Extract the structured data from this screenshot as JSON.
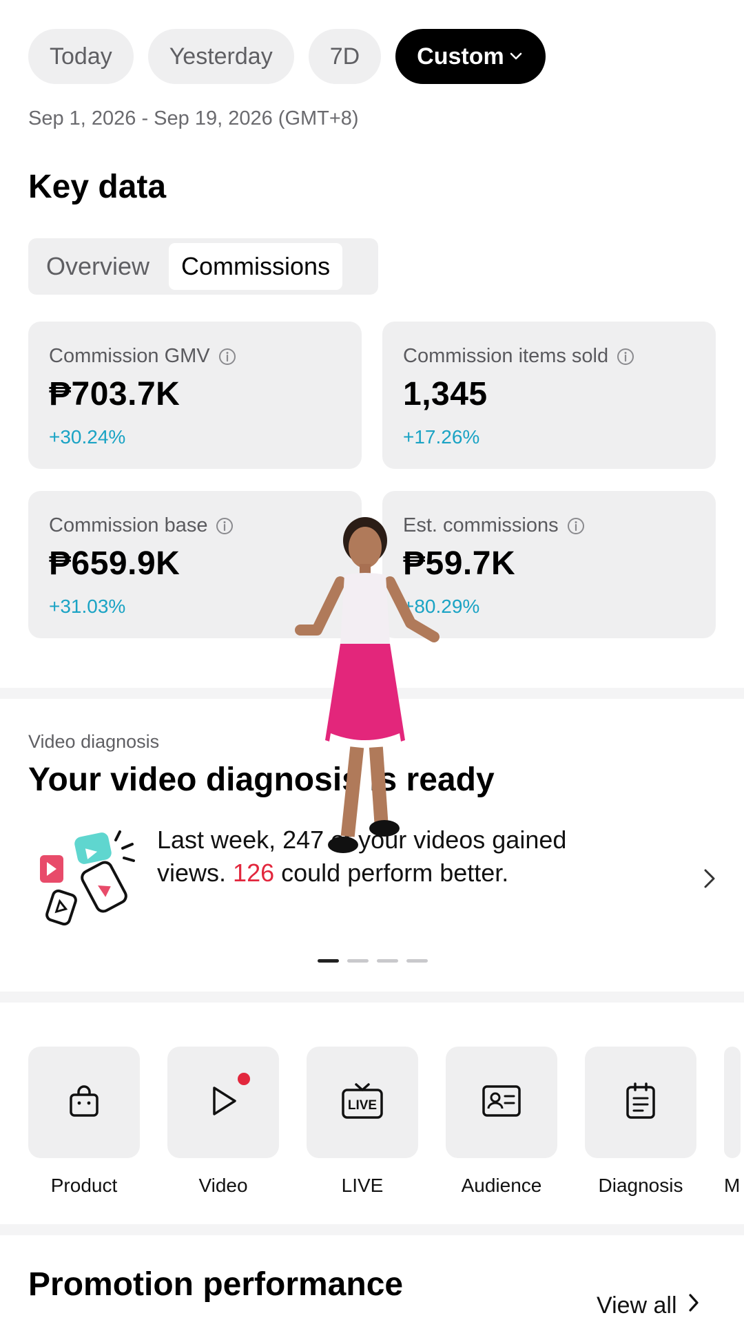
{
  "filters": {
    "pills": [
      {
        "label": "Today",
        "active": false
      },
      {
        "label": "Yesterday",
        "active": false
      },
      {
        "label": "7D",
        "active": false
      },
      {
        "label": "Custom",
        "active": true
      }
    ],
    "date_range": "Sep 1, 2026 - Sep 19, 2026 (GMT+8)"
  },
  "key_data": {
    "title": "Key data",
    "tabs": [
      {
        "label": "Overview",
        "active": false
      },
      {
        "label": "Commissions",
        "active": true
      }
    ],
    "cards": [
      {
        "label": "Commission GMV",
        "value": "₱703.7K",
        "delta": "+30.24%"
      },
      {
        "label": "Commission items sold",
        "value": "1,345",
        "delta": "+17.26%"
      },
      {
        "label": "Commission base",
        "value": "₱659.9K",
        "delta": "+31.03%"
      },
      {
        "label": "Est. commissions",
        "value": "₱59.7K",
        "delta": "+80.29%"
      }
    ]
  },
  "diagnosis": {
    "eyebrow": "Video diagnosis",
    "title": "Your video diagnosis is ready",
    "text_part1": "Last week, 247 of your videos gained views.",
    "highlight": "126",
    "text_part2": "could perform better.",
    "carousel_total": 4,
    "carousel_active": 1
  },
  "tools": [
    {
      "label": "Product",
      "icon": "shopping-bag-icon"
    },
    {
      "label": "Video",
      "icon": "play-icon"
    },
    {
      "label": "LIVE",
      "icon": "live-tv-icon"
    },
    {
      "label": "Audience",
      "icon": "id-card-icon"
    },
    {
      "label": "Diagnosis",
      "icon": "clipboard-icon"
    },
    {
      "label": "Ma",
      "icon": "more-tool-icon"
    }
  ],
  "promotion": {
    "title": "Promotion performance",
    "view_all": "View all"
  },
  "colors": {
    "accent_teal": "#1aa3c4",
    "highlight_red": "#e2273d",
    "pill_bg": "#efeff0",
    "active_pill_bg": "#000000"
  }
}
